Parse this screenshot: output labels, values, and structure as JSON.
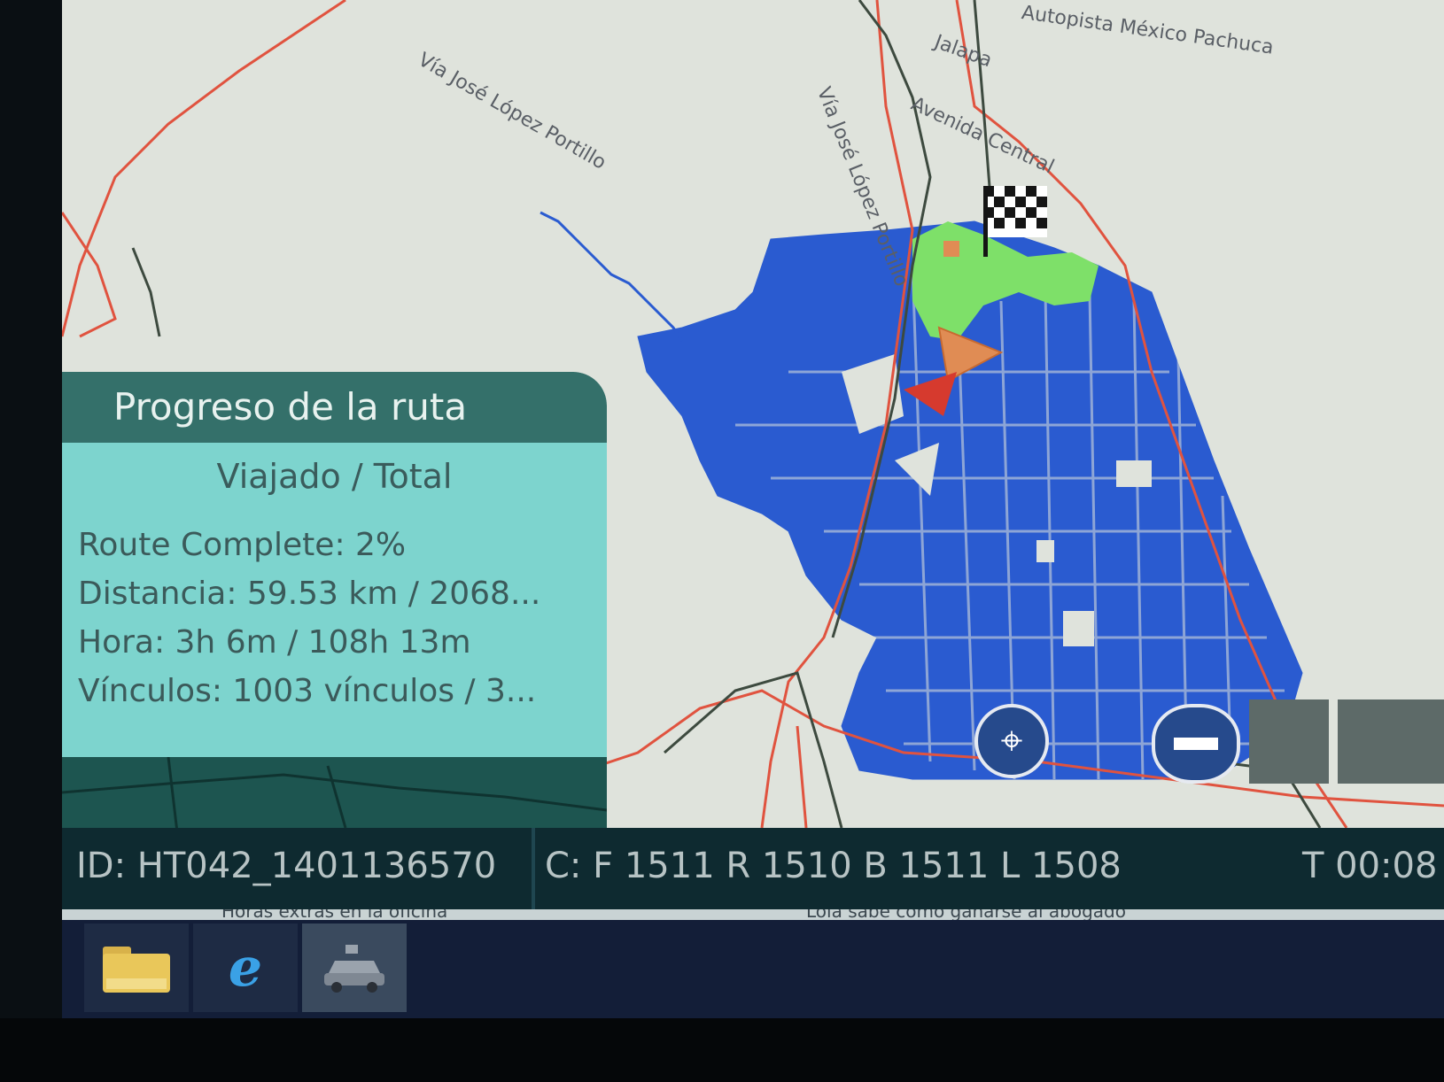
{
  "map": {
    "road_labels": [
      "Autopista México Pachuca",
      "Jalapa",
      "Vía José López Portillo",
      "Vía José López Portillo",
      "Avenida Central"
    ],
    "colors": {
      "background": "#dfe3dc",
      "network": "#2a5bd0",
      "highway": "#e0533f",
      "rail": "#3d4a3f",
      "completed": "#7ee069"
    },
    "markers": {
      "finish": "checkered-flag-icon",
      "current_position": "orange-triangle-icon",
      "start": "red-triangle-icon"
    },
    "controls": {
      "locate": "location-pin-icon",
      "zoom_out": "minus-icon"
    }
  },
  "progress_panel": {
    "title": "Progreso de la ruta",
    "subtitle": "Viajado / Total",
    "route_complete": "Route Complete: 2%",
    "route_complete_percent": 2,
    "distance": "Distancia: 59.53 km / 2068...",
    "time": "Hora: 3h 6m / 108h 13m",
    "links": "Vínculos: 1003 vínculos / 3..."
  },
  "status_bar": {
    "id": "ID: HT042_1401136570",
    "cameras": "C: F 1511 R 1510 B 1511 L 1508",
    "time": "T 00:08"
  },
  "ticker": {
    "left": "Horas extras en la oficina",
    "right": "Lola sabe cómo ganarse al abogado"
  },
  "taskbar": {
    "apps": [
      {
        "name": "Explorador de archivos",
        "icon": "folder-icon"
      },
      {
        "name": "Internet Explorer",
        "icon": "internet-explorer-icon"
      },
      {
        "name": "Mapping app",
        "icon": "car-icon"
      }
    ]
  }
}
